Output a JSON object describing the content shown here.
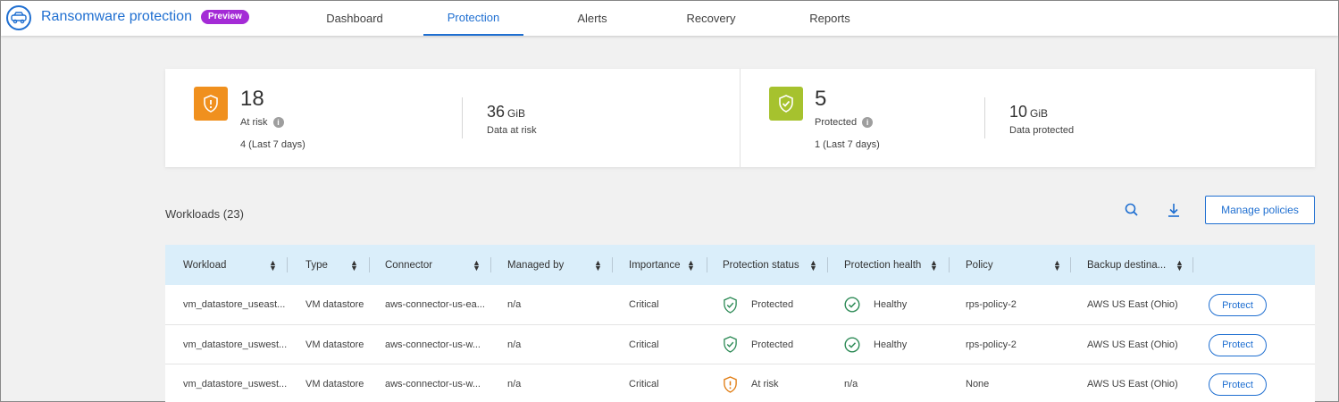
{
  "app": {
    "title": "Ransomware protection",
    "badge": "Preview",
    "brand_color": "#1f6fd1",
    "badge_color": "#a42bd6"
  },
  "nav": {
    "tabs": [
      {
        "label": "Dashboard",
        "active": false
      },
      {
        "label": "Protection",
        "active": true
      },
      {
        "label": "Alerts",
        "active": false
      },
      {
        "label": "Recovery",
        "active": false
      },
      {
        "label": "Reports",
        "active": false
      }
    ]
  },
  "summary": {
    "at_risk": {
      "icon": "shield-alert-icon",
      "color": "#f0901e",
      "count": "18",
      "label": "At risk",
      "note": "4 (Last 7 days)",
      "data_value": "36",
      "data_unit": "GiB",
      "data_label": "Data at risk"
    },
    "protected": {
      "icon": "shield-check-icon",
      "color": "#a6c22e",
      "count": "5",
      "label": "Protected",
      "note": "1 (Last 7 days)",
      "data_value": "10",
      "data_unit": "GiB",
      "data_label": "Data protected"
    }
  },
  "workloads": {
    "title": "Workloads (23)",
    "manage_button": "Manage policies",
    "columns": [
      "Workload",
      "Type",
      "Connector",
      "Managed by",
      "Importance",
      "Protection status",
      "Protection health",
      "Policy",
      "Backup destina..."
    ],
    "rows": [
      {
        "workload": "vm_datastore_useast...",
        "type": "VM datastore",
        "connector": "aws-connector-us-ea...",
        "managed_by": "n/a",
        "importance": "Critical",
        "status": "Protected",
        "status_icon": "shield-check-icon",
        "health": "Healthy",
        "health_icon": "check-circle-icon",
        "policy": "rps-policy-2",
        "backup": "AWS US East (Ohio)",
        "action": "Protect"
      },
      {
        "workload": "vm_datastore_uswest...",
        "type": "VM datastore",
        "connector": "aws-connector-us-w...",
        "managed_by": "n/a",
        "importance": "Critical",
        "status": "Protected",
        "status_icon": "shield-check-icon",
        "health": "Healthy",
        "health_icon": "check-circle-icon",
        "policy": "rps-policy-2",
        "backup": "AWS US East (Ohio)",
        "action": "Protect"
      },
      {
        "workload": "vm_datastore_uswest...",
        "type": "VM datastore",
        "connector": "aws-connector-us-w...",
        "managed_by": "n/a",
        "importance": "Critical",
        "status": "At risk",
        "status_icon": "shield-alert-icon",
        "health": "n/a",
        "health_icon": "",
        "policy": "None",
        "backup": "AWS US East (Ohio)",
        "action": "Protect"
      }
    ]
  }
}
